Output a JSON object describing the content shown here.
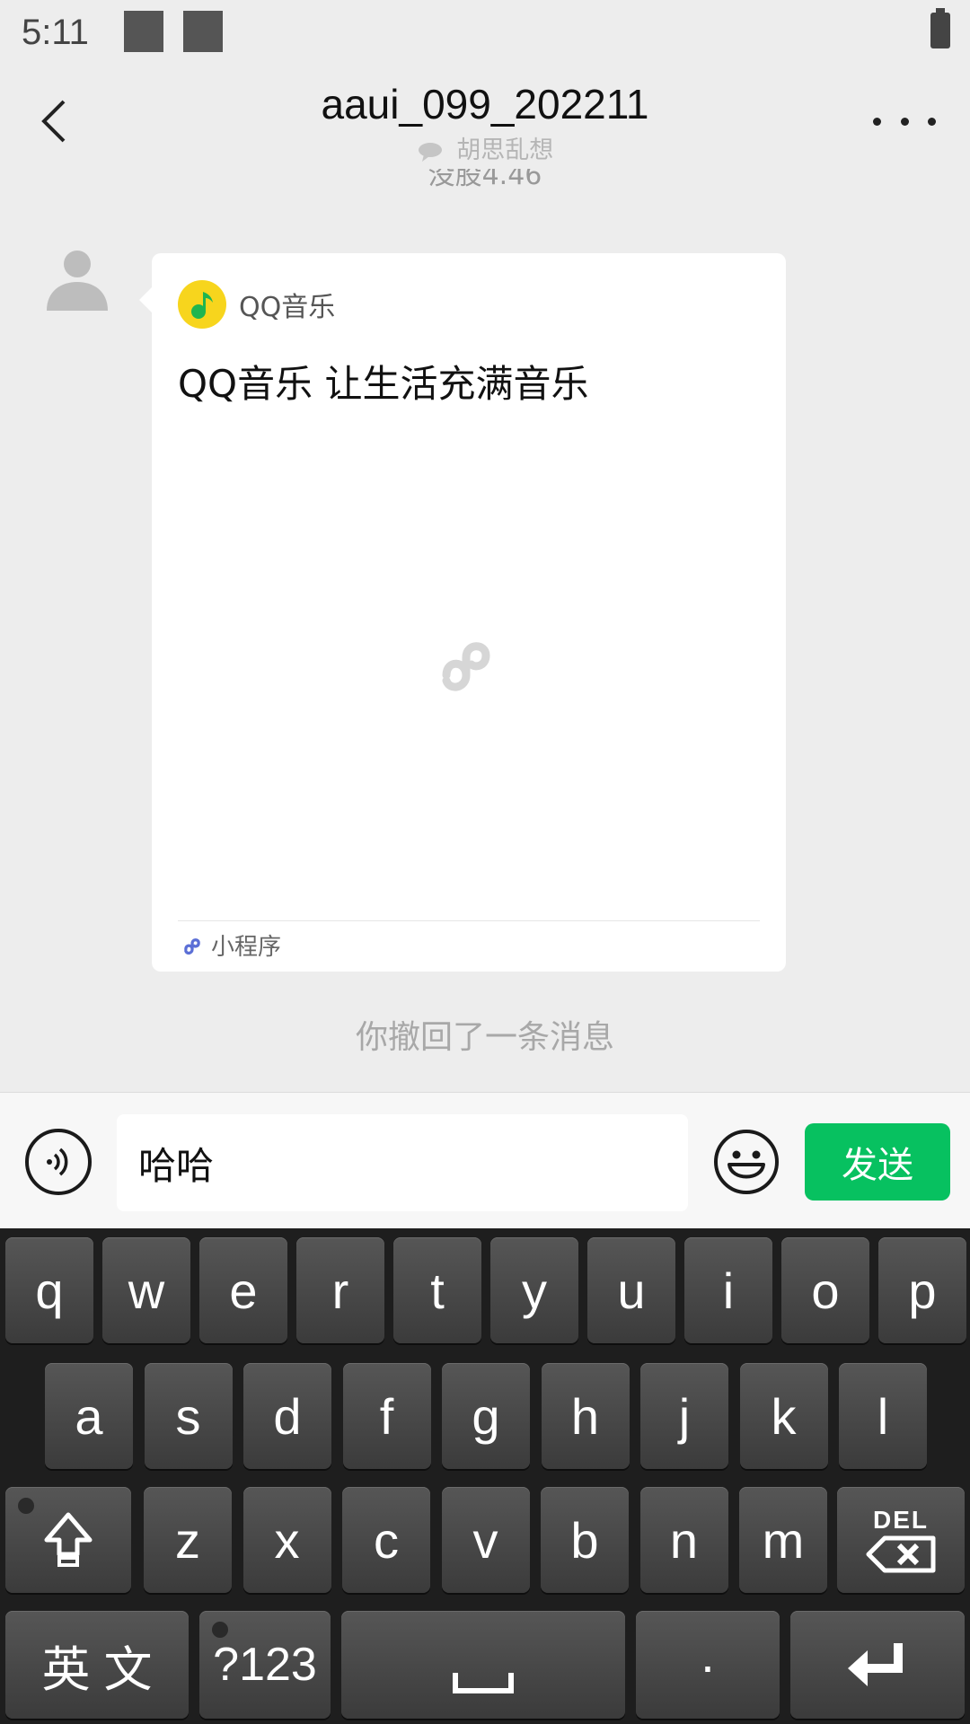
{
  "status_bar": {
    "time": "5:11"
  },
  "header": {
    "title": "aaui_099_202211",
    "subtitle": "胡思乱想",
    "scrolled_text": "没股4.46"
  },
  "message": {
    "app_name": "QQ音乐",
    "description": "QQ音乐 让生活充满音乐",
    "footer_label": "小程序"
  },
  "system_notice": "你撤回了一条消息",
  "input": {
    "value": "哈哈",
    "send_label": "发送"
  },
  "keyboard": {
    "row1": [
      "q",
      "w",
      "e",
      "r",
      "t",
      "y",
      "u",
      "i",
      "o",
      "p"
    ],
    "row2": [
      "a",
      "s",
      "d",
      "f",
      "g",
      "h",
      "j",
      "k",
      "l"
    ],
    "row3": [
      "z",
      "x",
      "c",
      "v",
      "b",
      "n",
      "m"
    ],
    "del_label": "DEL",
    "lang_label": "英 文",
    "symbols_label": "?123",
    "period_label": "·"
  },
  "colors": {
    "send_green": "#07c160",
    "qq_yellow": "#f7d51d",
    "keyboard_bg": "#1e1e1e"
  }
}
